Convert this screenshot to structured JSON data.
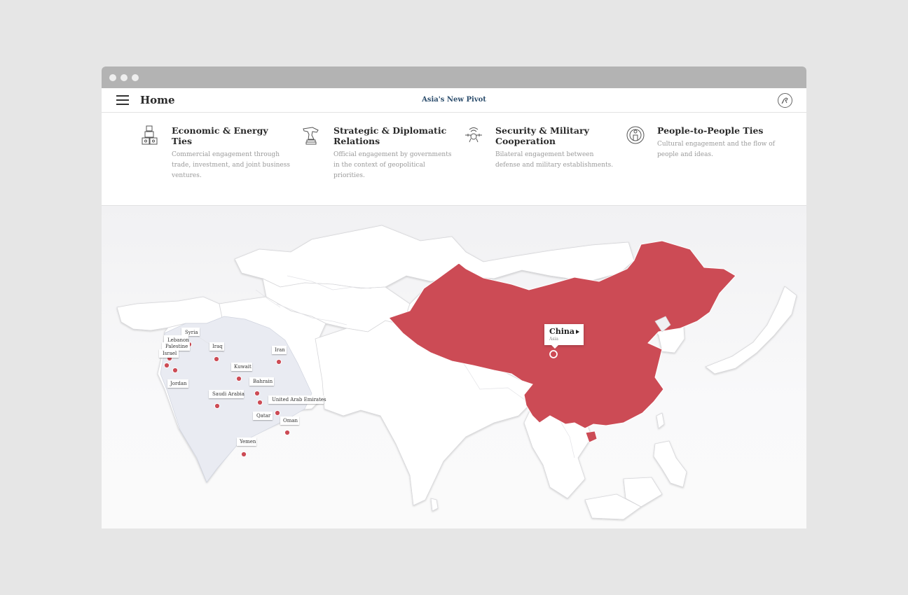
{
  "header": {
    "home_label": "Home",
    "site_title": "Asia's New Pivot"
  },
  "categories": [
    {
      "title": "Economic & Energy Ties",
      "desc": "Commercial engagement through trade, investment, and joint business ventures.",
      "icon": "crates-icon"
    },
    {
      "title": "Strategic & Diplomatic Relations",
      "desc": "Official engagement by governments in the context of geopolitical priorities.",
      "icon": "chess-knight-icon"
    },
    {
      "title": "Security & Military Cooperation",
      "desc": "Bilateral engagement between defense and military establishments.",
      "icon": "drone-icon"
    },
    {
      "title": "People-to-People Ties",
      "desc": "Cultural engagement and the flow of people and ideas.",
      "icon": "person-globe-icon"
    }
  ],
  "map": {
    "highlight_color": "#cc4b55",
    "region_fill": "#e9ebf2",
    "land_fill": "#ffffff",
    "selected_country": {
      "name": "China",
      "region": "Asia"
    },
    "countries": [
      "Syria",
      "Lebanon",
      "Palestine",
      "Israel",
      "Iraq",
      "Iran",
      "Kuwait",
      "Jordan",
      "Bahrain",
      "Saudi Arabia",
      "United Arab Emirates",
      "Qatar",
      "Oman",
      "Yemen"
    ]
  }
}
